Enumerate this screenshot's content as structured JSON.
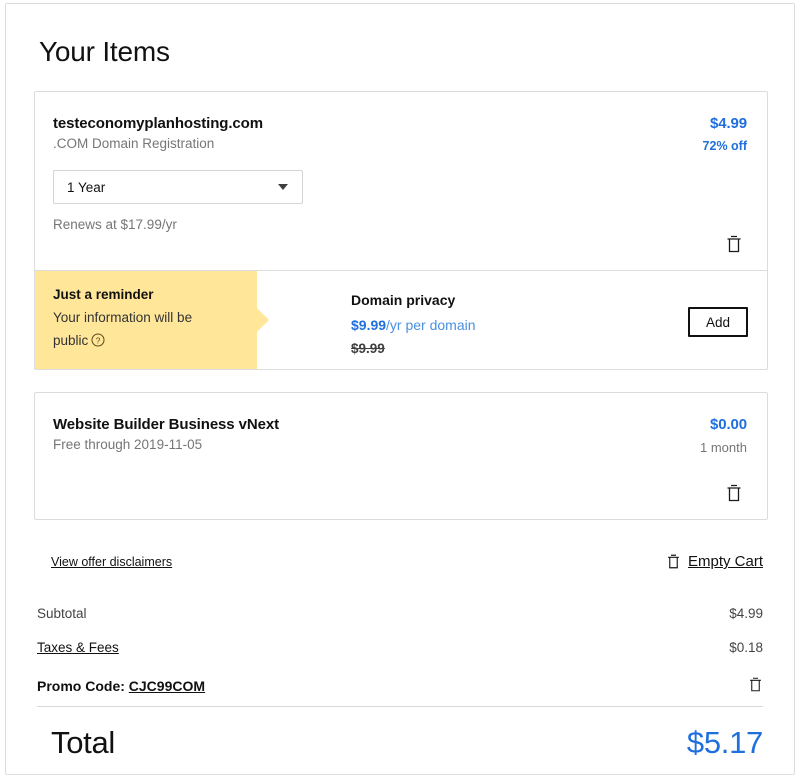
{
  "page": {
    "title": "Your Items"
  },
  "items": [
    {
      "name": "testeconomyplanhosting.com",
      "description": ".COM Domain Registration",
      "term_selected": "1 Year",
      "renews_note": "Renews at $17.99/yr",
      "price": "$4.99",
      "discount": "72% off",
      "delete_icon": "trash-icon"
    },
    {
      "name": "Website Builder Business vNext",
      "description": "Free through 2019-11-05",
      "price": "$0.00",
      "term": "1 month",
      "delete_icon": "trash-icon"
    }
  ],
  "privacy_offer": {
    "reminder_title": "Just a reminder",
    "reminder_text": "Your information will be public",
    "help_icon": "question-circle-icon",
    "title": "Domain privacy",
    "price": "$9.99",
    "price_suffix": "/yr per domain",
    "strike_price": "$9.99",
    "add_label": "Add"
  },
  "footer_links": {
    "disclaimers": "View offer disclaimers",
    "empty_cart": "Empty Cart",
    "empty_cart_icon": "trash-icon"
  },
  "totals": {
    "subtotal_label": "Subtotal",
    "subtotal_value": "$4.99",
    "taxes_label": "Taxes & Fees",
    "taxes_value": "$0.18",
    "promo_label": "Promo Code:",
    "promo_code": "CJC99COM",
    "promo_delete_icon": "trash-icon",
    "total_label": "Total",
    "total_value": "$5.17"
  },
  "colors": {
    "accent_blue": "#1f6fdd",
    "reminder_yellow": "#ffe699",
    "muted_gray": "#767676"
  }
}
